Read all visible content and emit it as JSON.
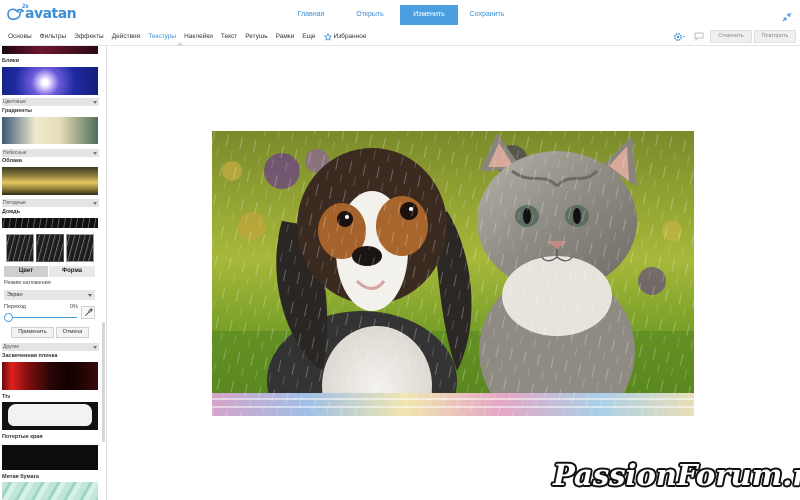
{
  "app": {
    "logo_text": "avatan",
    "logo_sup": "2e"
  },
  "nav": {
    "items": [
      {
        "label": "Главная",
        "active": false
      },
      {
        "label": "Открыть",
        "active": false
      },
      {
        "label": "Изменить",
        "active": true
      },
      {
        "label": "Сохранить",
        "active": false
      }
    ]
  },
  "tabs": [
    {
      "label": "Основы",
      "active": false
    },
    {
      "label": "Фильтры",
      "active": false
    },
    {
      "label": "Эффекты",
      "active": false
    },
    {
      "label": "Действия",
      "active": false
    },
    {
      "label": "Текстуры",
      "active": true
    },
    {
      "label": "Наклейки",
      "active": false
    },
    {
      "label": "Текст",
      "active": false
    },
    {
      "label": "Ретушь",
      "active": false
    },
    {
      "label": "Рамки",
      "active": false
    },
    {
      "label": "Еще",
      "active": false
    }
  ],
  "favorites_label": "Избранное",
  "toolbar": {
    "undo_label": "Отменить",
    "redo_label": "Повторить"
  },
  "sidebar": {
    "sections": {
      "blink": "Блики",
      "color_cat": "Цветовые",
      "gradients": "Градиенты",
      "sky_cat": "Небесные",
      "clouds": "Облака",
      "weather_cat": "Погодные",
      "rain": "Дождь",
      "other_cat": "Другие",
      "light_leak": "Засвеченная пленка",
      "tv": "Ttv",
      "worn_edge": "Потертые края",
      "crumpled_paper": "Мятая бумага"
    },
    "panel": {
      "tab_color": "Цвет",
      "tab_shape": "Форма",
      "blend_label": "Режим наложения",
      "blend_value": "Экран",
      "transition_label": "Переход",
      "transition_value": "0%",
      "apply_label": "Применить",
      "cancel_label": "Отмена"
    }
  },
  "colors": {
    "accent": "#4a9fe0",
    "link": "#3d8fd6"
  },
  "watermark": "PassionForum.ru"
}
